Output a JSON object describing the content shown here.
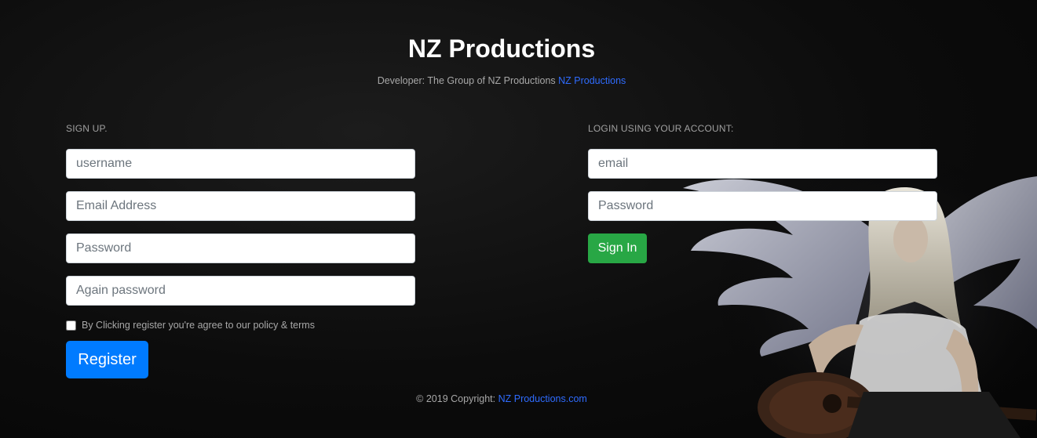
{
  "header": {
    "title": "NZ Productions",
    "developer_prefix": "Developer: The Group of NZ Productions",
    "developer_link": "NZ Productions"
  },
  "signup": {
    "label": "SIGN UP.",
    "username_placeholder": "username",
    "email_placeholder": "Email Address",
    "password_placeholder": "Password",
    "again_password_placeholder": "Again password",
    "terms_label": "By Clicking register you're agree to our policy & terms",
    "register_label": "Register"
  },
  "login": {
    "label": "LOGIN USING YOUR ACCOUNT:",
    "email_placeholder": "email",
    "password_placeholder": "Password",
    "signin_label": "Sign In"
  },
  "footer": {
    "copyright": "© 2019 Copyright:",
    "link": "NZ Productions.com"
  },
  "colors": {
    "register_button": "#007bff",
    "signin_button": "#28a745",
    "link": "#2f6cff"
  }
}
